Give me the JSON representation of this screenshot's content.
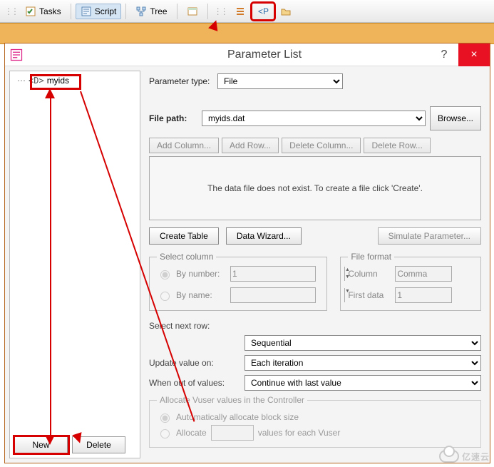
{
  "toolbar": {
    "tasks": "Tasks",
    "script": "Script",
    "tree": "Tree"
  },
  "window": {
    "title": "Parameter List",
    "help": "?",
    "close": "×"
  },
  "tree": {
    "item": "myids",
    "new_btn": "New",
    "delete_btn": "Delete"
  },
  "form": {
    "param_type_lbl": "Parameter type:",
    "param_type_val": "File",
    "file_path_lbl": "File path:",
    "file_path_val": "myids.dat",
    "browse": "Browse...",
    "add_col": "Add Column...",
    "add_row": "Add Row...",
    "del_col": "Delete Column...",
    "del_row": "Delete Row...",
    "grid_msg": "The data file does not exist. To create a file click 'Create'.",
    "create_table": "Create Table",
    "data_wizard": "Data Wizard...",
    "sim_param": "Simulate Parameter...",
    "sel_col_legend": "Select column",
    "by_number": "By number:",
    "by_number_val": "1",
    "by_name": "By name:",
    "ff_legend": "File format",
    "ff_col": "Column",
    "ff_col_val": "Comma",
    "ff_first": "First data",
    "ff_first_val": "1",
    "sel_next": "Select next row:",
    "sel_next_val": "Sequential",
    "upd_lbl": "Update value on:",
    "upd_val": "Each iteration",
    "oov_lbl": "When out of values:",
    "oov_val": "Continue with last value",
    "alloc_legend": "Allocate Vuser values in the Controller",
    "alloc_auto": "Automatically allocate block size",
    "alloc_manual": "Allocate",
    "alloc_suffix": "values for each Vuser"
  },
  "watermark": "亿速云"
}
